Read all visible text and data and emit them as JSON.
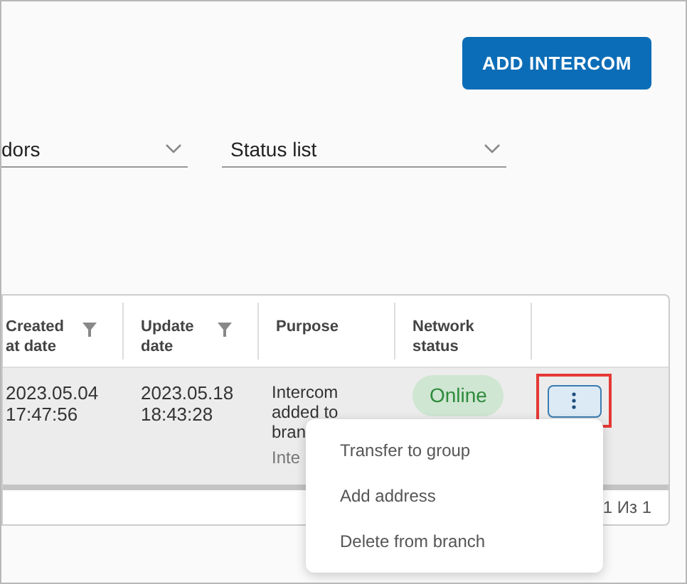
{
  "add_button": "ADD INTERCOM",
  "filters": [
    {
      "value": "dors"
    },
    {
      "value": "Status list"
    }
  ],
  "table": {
    "columns": [
      {
        "label": "Created at date",
        "filter": true
      },
      {
        "label": "Update date",
        "filter": true
      },
      {
        "label": "Purpose",
        "filter": false
      },
      {
        "label": "Network status",
        "filter": false
      }
    ],
    "rows": [
      {
        "created": "2023.05.04 17:47:56",
        "updated": "2023.05.18 18:43:28",
        "purpose": "Intercom added to bran",
        "purpose_extra": "Inte",
        "status": "Online",
        "highlighted": true
      }
    ]
  },
  "menu": {
    "items": [
      "Transfer to group",
      "Add address",
      "Delete from branch"
    ]
  },
  "pagination": "1 Из 1"
}
